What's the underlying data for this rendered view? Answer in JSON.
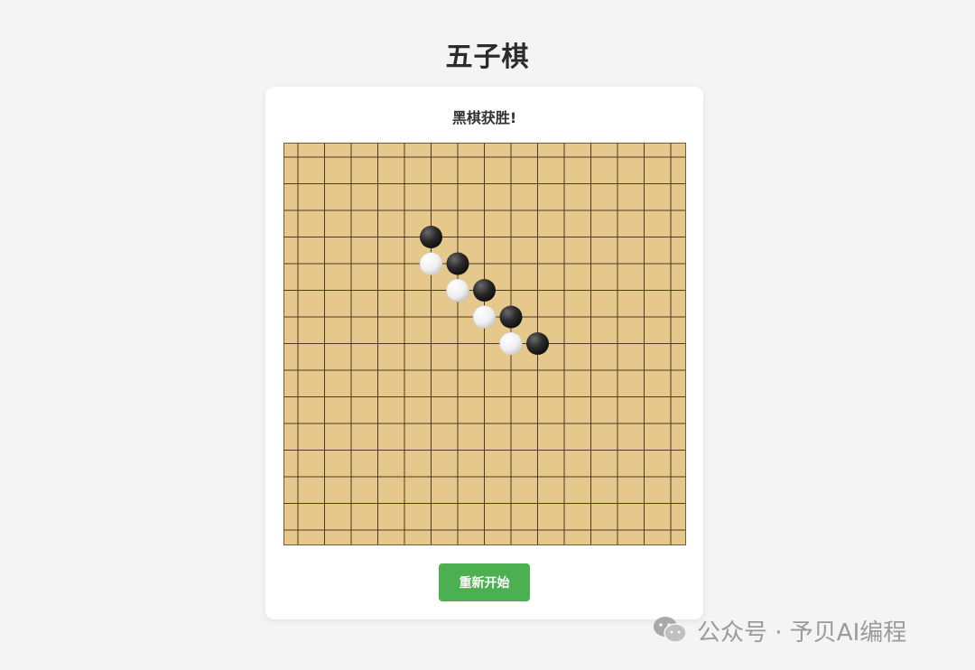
{
  "title": "五子棋",
  "status_text": "黑棋获胜!",
  "restart_label": "重新开始",
  "watermark_text": "公众号 · 予贝AI编程",
  "board": {
    "size": 15,
    "background": "#e6c88c",
    "line_color": "#4a3a22",
    "stones": [
      {
        "row": 3,
        "col": 5,
        "color": "black"
      },
      {
        "row": 4,
        "col": 5,
        "color": "white"
      },
      {
        "row": 4,
        "col": 6,
        "color": "black"
      },
      {
        "row": 5,
        "col": 6,
        "color": "white"
      },
      {
        "row": 5,
        "col": 7,
        "color": "black"
      },
      {
        "row": 6,
        "col": 7,
        "color": "white"
      },
      {
        "row": 6,
        "col": 8,
        "color": "black"
      },
      {
        "row": 7,
        "col": 8,
        "color": "white"
      },
      {
        "row": 7,
        "col": 9,
        "color": "black"
      }
    ]
  },
  "colors": {
    "accent": "#4caf50",
    "page_background": "#f4f4f4"
  },
  "icons": {
    "watermark": "wechat-icon"
  }
}
